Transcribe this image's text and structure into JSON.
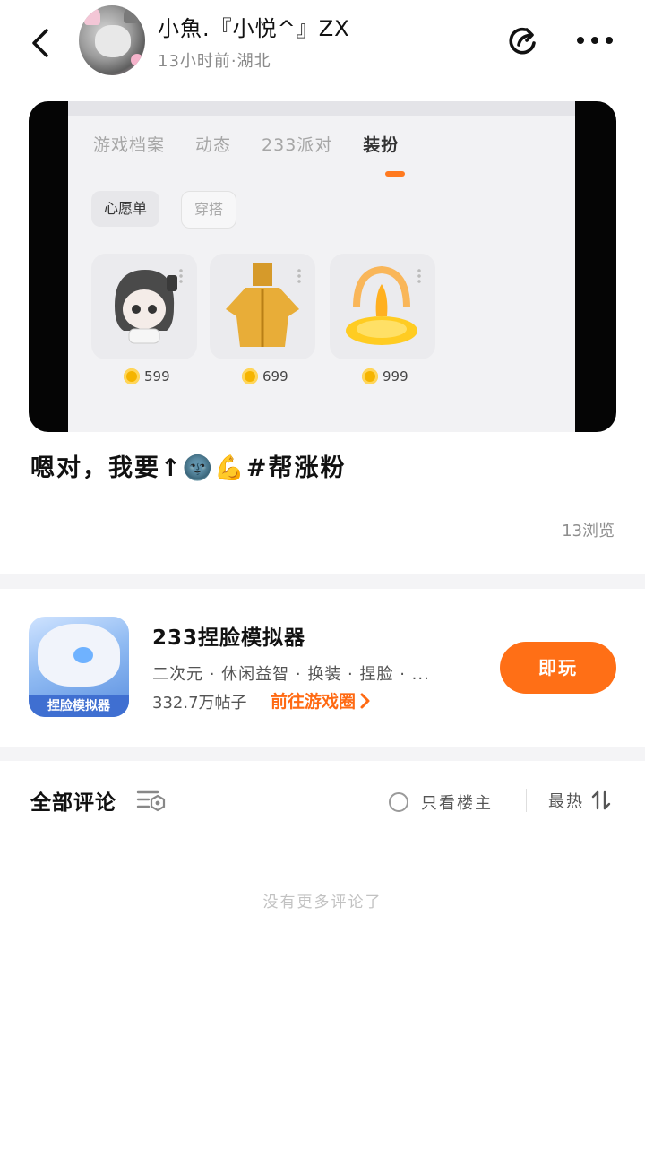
{
  "header": {
    "back_icon": "chevron-left-icon",
    "username": "小魚.『小悦^』ZX",
    "meta": "13小时前·湖北",
    "share_icon": "share-icon",
    "more_icon": "more-horizontal-icon"
  },
  "media": {
    "tabs": [
      "游戏档案",
      "动态",
      "233派对",
      "装扮"
    ],
    "active_tab": "装扮",
    "chips": [
      "心愿单",
      "穿搭"
    ],
    "items": [
      {
        "price": "599"
      },
      {
        "price": "699"
      },
      {
        "price": "999"
      }
    ]
  },
  "post": {
    "caption": "嗯对，我要↑🌚💪#帮涨粉",
    "views": "13浏览"
  },
  "game": {
    "title": "233捏脸模拟器",
    "tags": "二次元 · 休闲益智 · 换装 · 捏脸 · ...",
    "posts": "332.7万帖子",
    "link": "前往游戏圈",
    "play_label": "即玩",
    "icon_banner": "捏脸模拟器"
  },
  "comments": {
    "title": "全部评论",
    "op_only": "只看楼主",
    "sort": "最热",
    "empty": "没有更多评论了"
  },
  "colors": {
    "accent": "#ff6f16",
    "link": "#ff6a13"
  }
}
